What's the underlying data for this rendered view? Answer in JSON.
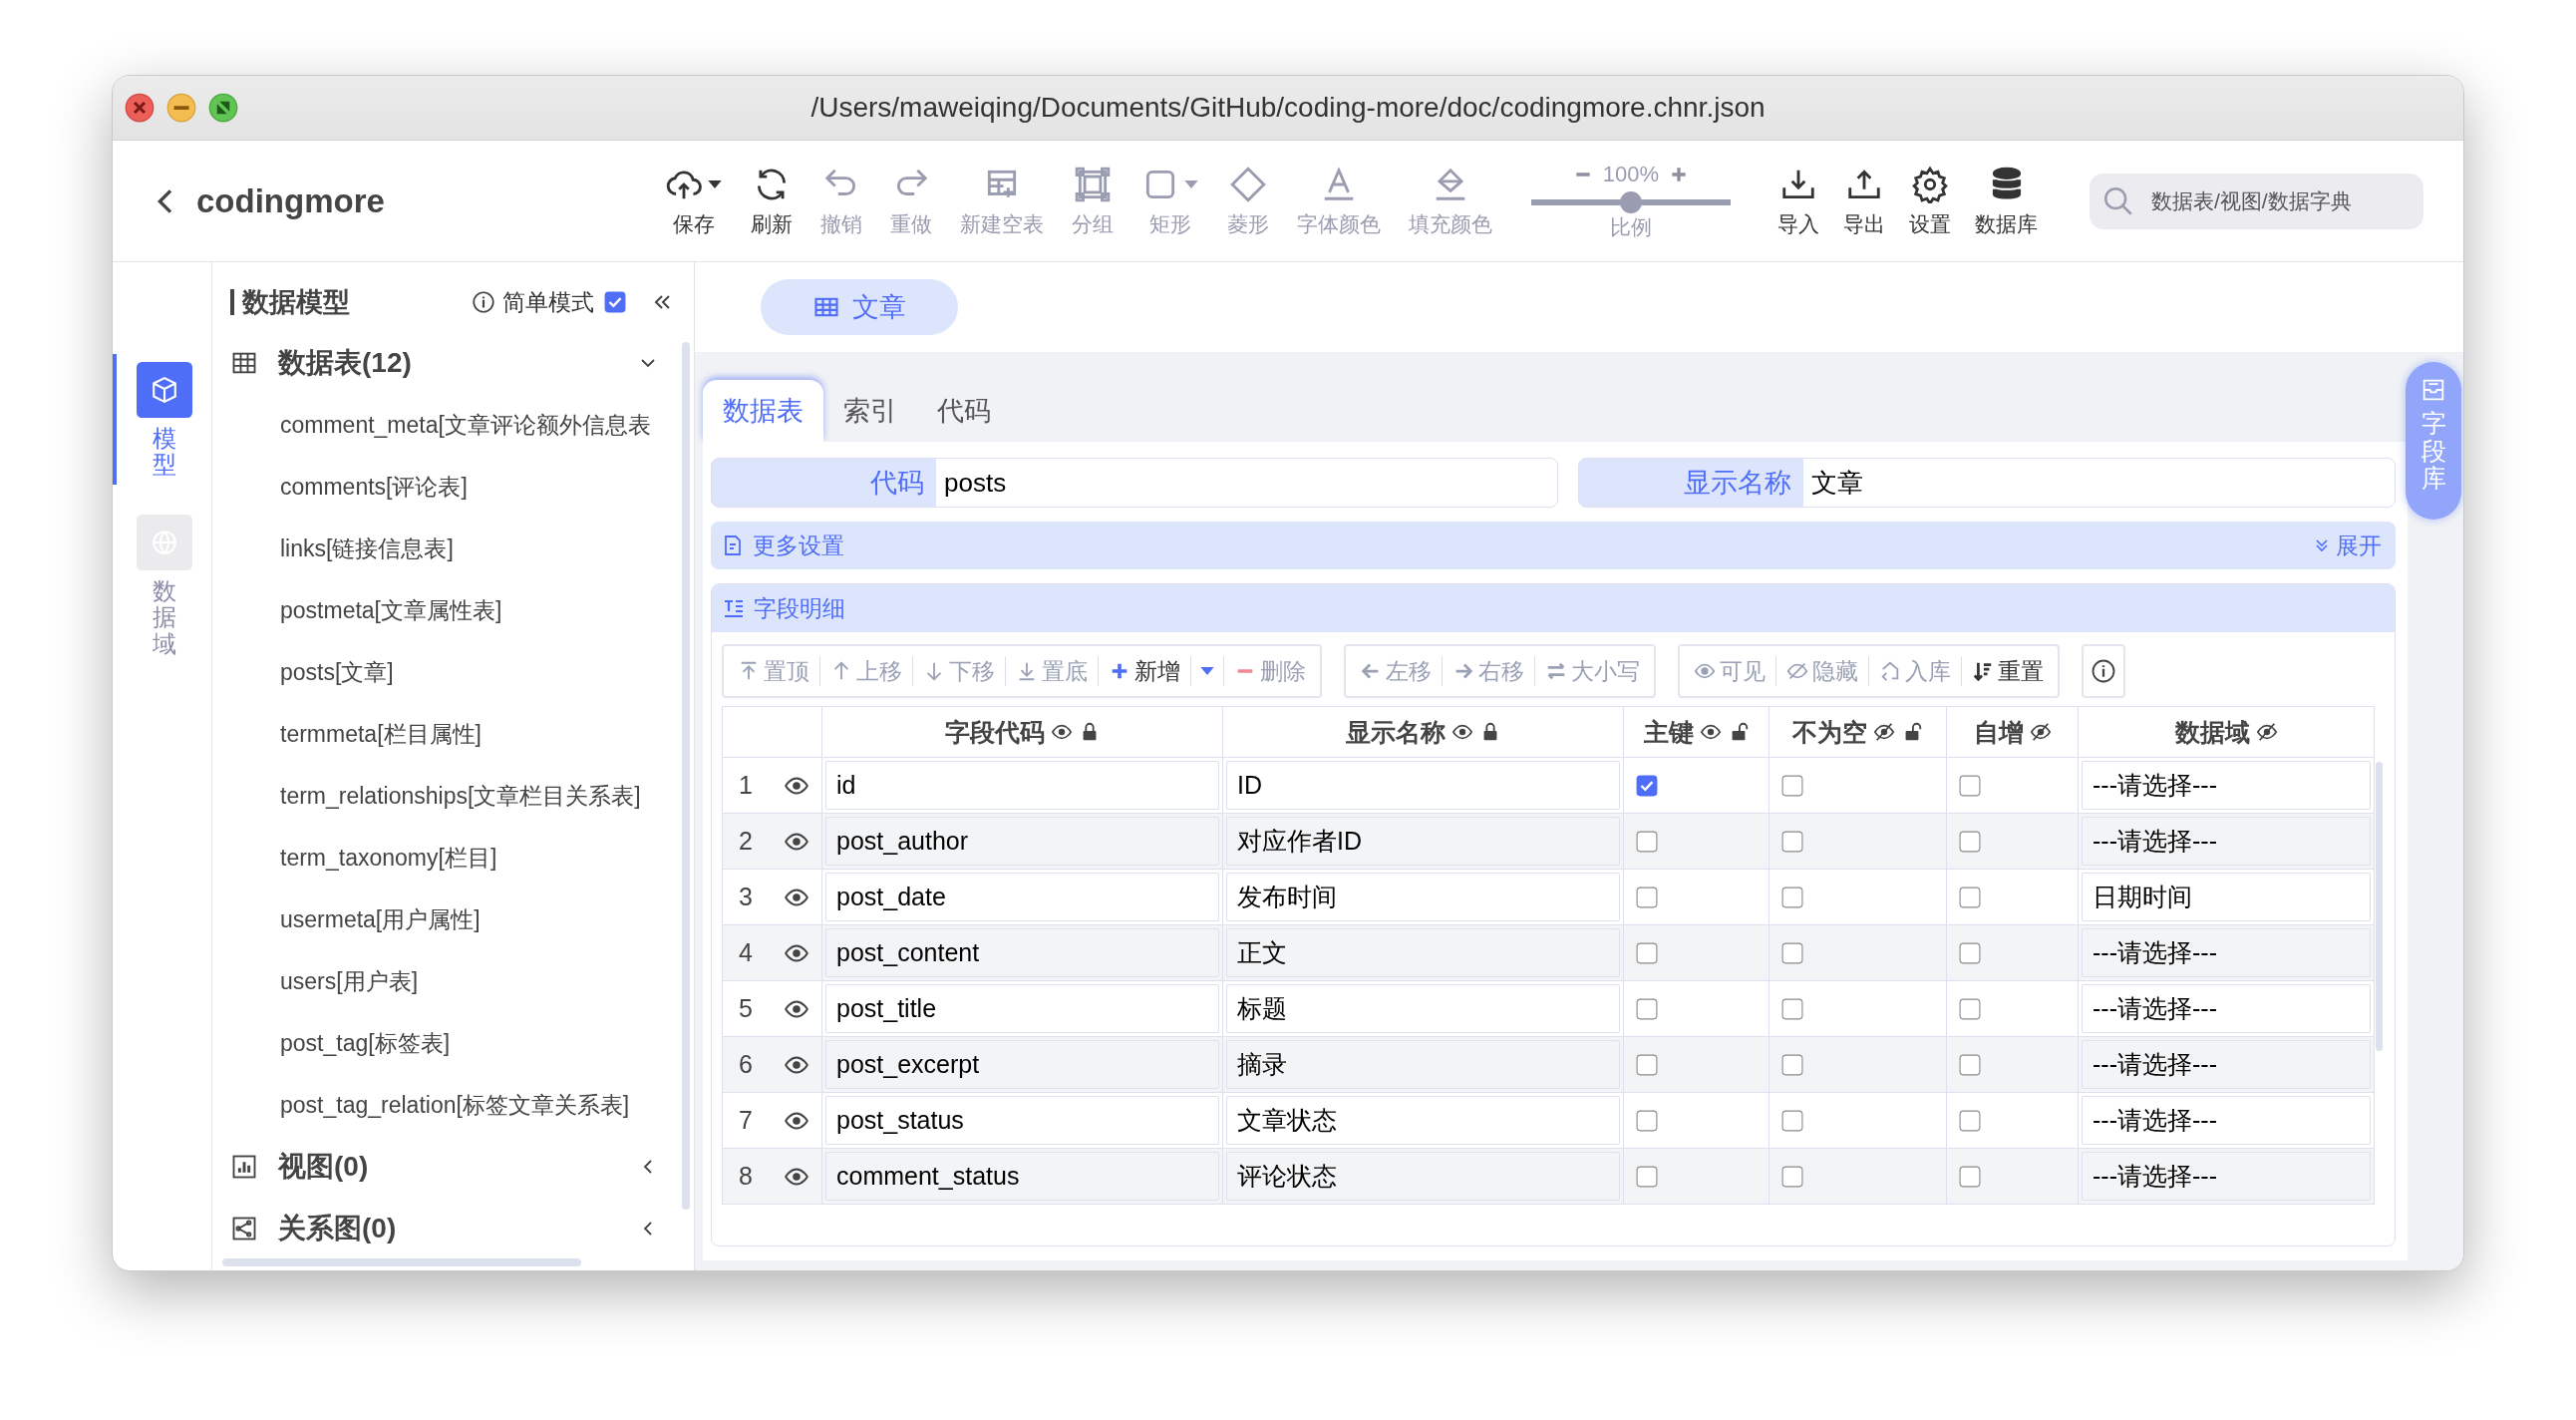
{
  "window": {
    "title": "/Users/maweiqing/Documents/GitHub/coding-more/doc/codingmore.chnr.json"
  },
  "header": {
    "back_label": "codingmore"
  },
  "toolbar": {
    "items": [
      {
        "label": "保存",
        "disabled": false,
        "has_menu": true
      },
      {
        "label": "刷新",
        "disabled": false,
        "has_menu": false
      },
      {
        "label": "撤销",
        "disabled": true,
        "has_menu": false
      },
      {
        "label": "重做",
        "disabled": true,
        "has_menu": false
      },
      {
        "label": "新建空表",
        "disabled": true,
        "has_menu": false
      },
      {
        "label": "分组",
        "disabled": true,
        "has_menu": false
      },
      {
        "label": "矩形",
        "disabled": true,
        "has_menu": true
      },
      {
        "label": "菱形",
        "disabled": true,
        "has_menu": false
      },
      {
        "label": "字体颜色",
        "disabled": true,
        "has_menu": false
      },
      {
        "label": "填充颜色",
        "disabled": true,
        "has_menu": false
      }
    ],
    "zoom": {
      "value": "100%",
      "label": "比例",
      "level": 0.5
    },
    "right_items": [
      {
        "label": "导入"
      },
      {
        "label": "导出"
      },
      {
        "label": "设置"
      },
      {
        "label": "数据库"
      }
    ],
    "search": {
      "placeholder": "数据表/视图/数据字典"
    }
  },
  "rail": [
    {
      "label": "模型",
      "selected": true
    },
    {
      "label": "数据域",
      "selected": false
    }
  ],
  "sidebar": {
    "title": "数据模型",
    "simple_mode": {
      "label": "简单模式",
      "checked": true
    },
    "groups": [
      {
        "label": "数据表(12)",
        "expanded": true,
        "children": [
          "comment_meta[文章评论额外信息表",
          "comments[评论表]",
          "links[链接信息表]",
          "postmeta[文章属性表]",
          "posts[文章]",
          "termmeta[栏目属性]",
          "term_relationships[文章栏目关系表]",
          "term_taxonomy[栏目]",
          "usermeta[用户属性]",
          "users[用户表]",
          "post_tag[标签表]",
          "post_tag_relation[标签文章关系表]"
        ]
      },
      {
        "label": "视图(0)",
        "expanded": false
      },
      {
        "label": "关系图(0)",
        "expanded": false
      }
    ]
  },
  "open_tabs": [
    {
      "label": "文章",
      "selected": true
    }
  ],
  "editor": {
    "tabs": [
      {
        "label": "数据表",
        "selected": true
      },
      {
        "label": "索引",
        "selected": false
      },
      {
        "label": "代码",
        "selected": false
      }
    ],
    "fields": [
      {
        "label": "代码",
        "value": "posts"
      },
      {
        "label": "显示名称",
        "value": "文章"
      }
    ],
    "more_settings": {
      "label": "更多设置",
      "toggle": "展开"
    },
    "field_library": "字段库",
    "details": {
      "title": "字段明细",
      "tool_groups": [
        [
          {
            "label": "置顶",
            "disabled": true,
            "has_menu": false
          },
          {
            "label": "上移",
            "disabled": true,
            "has_menu": false
          },
          {
            "label": "下移",
            "disabled": true,
            "has_menu": false
          },
          {
            "label": "置底",
            "disabled": true,
            "has_menu": false
          },
          {
            "label": "新增",
            "disabled": false,
            "has_menu": true
          },
          {
            "label": "删除",
            "disabled": true,
            "has_menu": false
          }
        ],
        [
          {
            "label": "左移",
            "disabled": true,
            "has_menu": false
          },
          {
            "label": "右移",
            "disabled": true,
            "has_menu": false
          },
          {
            "label": "大小写",
            "disabled": true,
            "has_menu": false
          }
        ],
        [
          {
            "label": "可见",
            "disabled": true,
            "has_menu": false
          },
          {
            "label": "隐藏",
            "disabled": true,
            "has_menu": false
          },
          {
            "label": "入库",
            "disabled": true,
            "has_menu": false
          },
          {
            "label": "重置",
            "disabled": false,
            "has_menu": false
          }
        ]
      ],
      "table": {
        "columns": [
          {
            "label": "字段代码",
            "visible": true,
            "locked": true
          },
          {
            "label": "显示名称",
            "visible": true,
            "locked": true
          },
          {
            "label": "主键",
            "visible": true,
            "locked": false
          },
          {
            "label": "不为空",
            "visible": false,
            "locked": false
          },
          {
            "label": "自增",
            "visible": false
          },
          {
            "label": "数据域",
            "visible": false
          }
        ],
        "rows": [
          {
            "number": "1",
            "visible": true,
            "code": "id",
            "name": "ID",
            "primary_key": true,
            "not_null": false,
            "auto_increment": false,
            "domain": "---请选择---"
          },
          {
            "number": "2",
            "visible": true,
            "code": "post_author",
            "name": "对应作者ID",
            "primary_key": false,
            "not_null": false,
            "auto_increment": false,
            "domain": "---请选择---"
          },
          {
            "number": "3",
            "visible": true,
            "code": "post_date",
            "name": "发布时间",
            "primary_key": false,
            "not_null": false,
            "auto_increment": false,
            "domain": "日期时间"
          },
          {
            "number": "4",
            "visible": true,
            "code": "post_content",
            "name": "正文",
            "primary_key": false,
            "not_null": false,
            "auto_increment": false,
            "domain": "---请选择---"
          },
          {
            "number": "5",
            "visible": true,
            "code": "post_title",
            "name": "标题",
            "primary_key": false,
            "not_null": false,
            "auto_increment": false,
            "domain": "---请选择---"
          },
          {
            "number": "6",
            "visible": true,
            "code": "post_excerpt",
            "name": "摘录",
            "primary_key": false,
            "not_null": false,
            "auto_increment": false,
            "domain": "---请选择---"
          },
          {
            "number": "7",
            "visible": true,
            "code": "post_status",
            "name": "文章状态",
            "primary_key": false,
            "not_null": false,
            "auto_increment": false,
            "domain": "---请选择---"
          },
          {
            "number": "8",
            "visible": true,
            "code": "comment_status",
            "name": "评论状态",
            "primary_key": false,
            "not_null": false,
            "auto_increment": false,
            "domain": "---请选择---"
          }
        ]
      }
    }
  }
}
